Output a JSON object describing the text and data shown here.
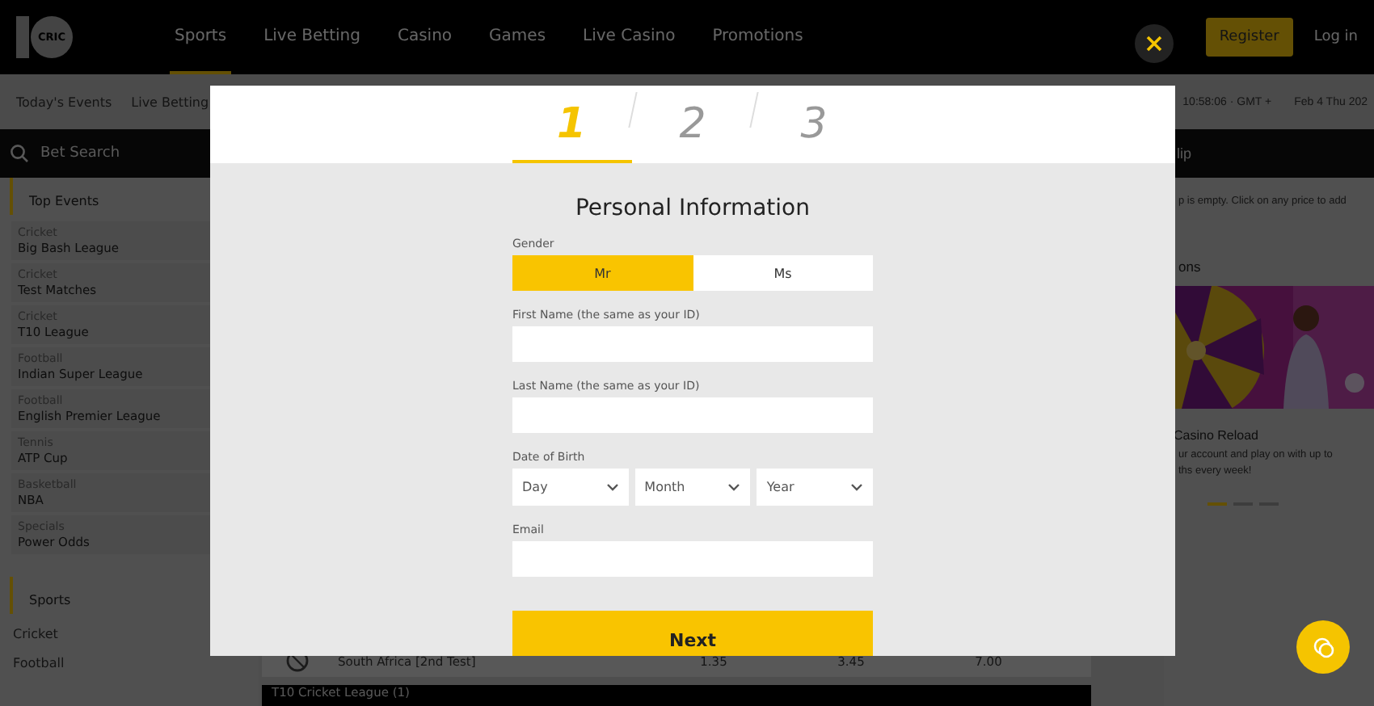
{
  "header": {
    "logo": "CRIC",
    "nav": [
      {
        "label": "Sports",
        "selected": true
      },
      {
        "label": "Live Betting",
        "selected": false
      },
      {
        "label": "Casino",
        "selected": false
      },
      {
        "label": "Games",
        "selected": false
      },
      {
        "label": "Live Casino",
        "selected": false
      },
      {
        "label": "Promotions",
        "selected": false
      }
    ],
    "register": "Register",
    "login": "Log in"
  },
  "subnav": {
    "links": [
      "Today's Events",
      "Live Betting"
    ],
    "time": "10:58:06 · GMT +",
    "date": "Feb 4 Thu 202"
  },
  "sidebar": {
    "search": "Bet Search",
    "top_events_title": "Top Events",
    "top_events": [
      {
        "category": "Cricket",
        "name": "Big Bash League"
      },
      {
        "category": "Cricket",
        "name": "Test Matches"
      },
      {
        "category": "Cricket",
        "name": "T10 League"
      },
      {
        "category": "Football",
        "name": "Indian Super League"
      },
      {
        "category": "Football",
        "name": "English Premier League"
      },
      {
        "category": "Tennis",
        "name": "ATP Cup"
      },
      {
        "category": "Basketball",
        "name": "NBA"
      },
      {
        "category": "Specials",
        "name": "Power Odds"
      }
    ],
    "sports_title": "Sports",
    "sports": [
      "Cricket",
      "Football"
    ]
  },
  "events": {
    "row": {
      "name": "South Africa [2nd Test]",
      "odds": [
        "1.35",
        "3.45",
        "7.00"
      ]
    },
    "league_bar": "T10 Cricket League (1)"
  },
  "right_panel": {
    "betslip_title": "lip",
    "betslip_text": "p is empty. Click on any price to add",
    "promotions_title": "ons",
    "promo": {
      "kind": "picture",
      "title": "Casino Reload",
      "lines": [
        "ur account and play on with up to",
        "ths every week!"
      ]
    },
    "dots": [
      {
        "selected": true
      },
      {
        "selected": false
      },
      {
        "selected": false
      }
    ]
  },
  "modal": {
    "steps": [
      {
        "label": "1",
        "selected": true
      },
      {
        "label": "2",
        "selected": false
      },
      {
        "label": "3",
        "selected": false
      }
    ],
    "title": "Personal Information",
    "gender": {
      "label": "Gender",
      "options": [
        {
          "label": "Mr",
          "selected": true
        },
        {
          "label": "Ms",
          "selected": false
        }
      ]
    },
    "fields": [
      {
        "kind": "text",
        "label": "First Name (the same as your ID)"
      },
      {
        "kind": "text",
        "label": "Last Name (the same as your ID)"
      },
      {
        "kind": "select",
        "label": "Date of Birth",
        "selects": [
          "Day",
          "Month",
          "Year"
        ]
      },
      {
        "kind": "text",
        "label": "Email"
      }
    ],
    "next": "Next"
  }
}
